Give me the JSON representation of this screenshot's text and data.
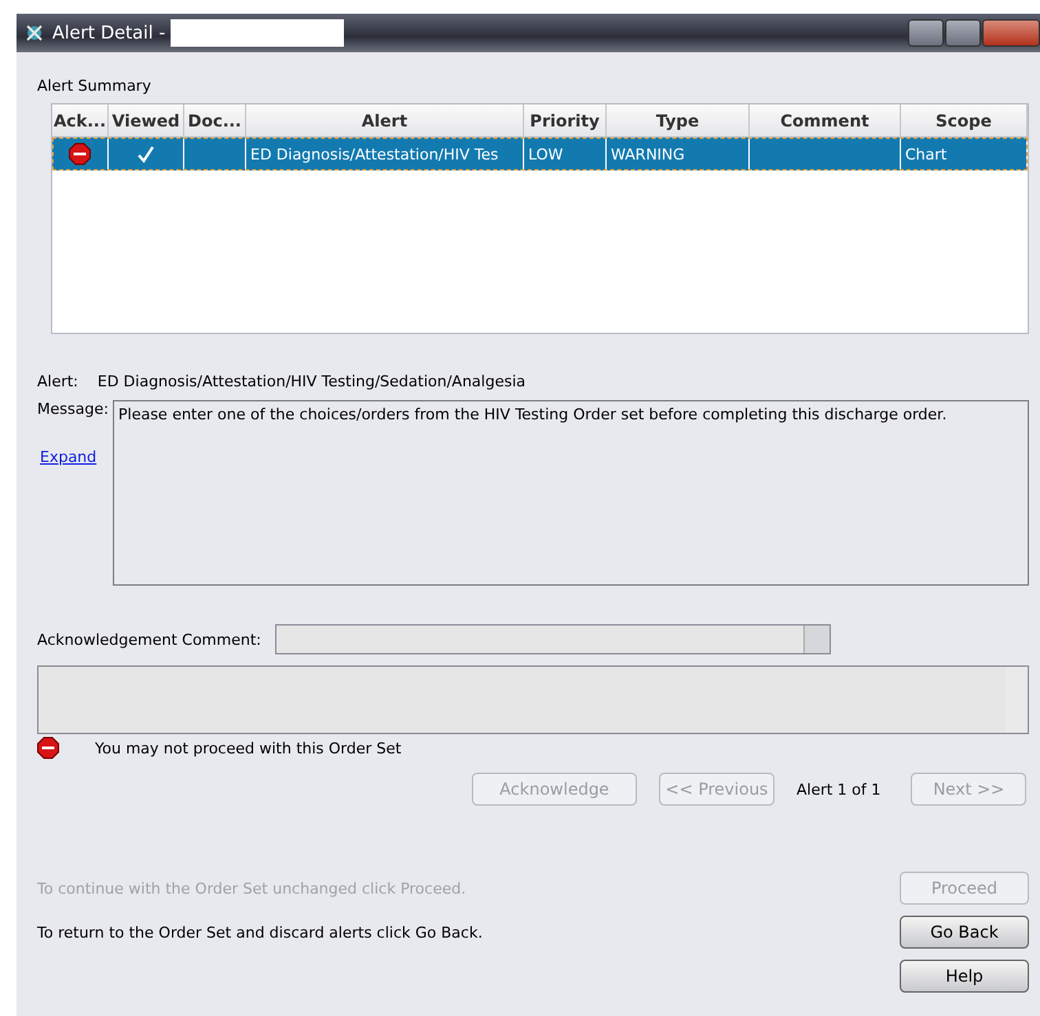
{
  "window": {
    "title": "Alert Detail -"
  },
  "summary": {
    "heading": "Alert Summary",
    "columns": [
      "Ack...",
      "Viewed",
      "Doc...",
      "Alert",
      "Priority",
      "Type",
      "Comment",
      "Scope"
    ],
    "rows": [
      {
        "selected": true,
        "stop": true,
        "viewed": true,
        "alert": "ED Diagnosis/Attestation/HIV Tes",
        "priority": "LOW",
        "type": "WARNING",
        "scope": "Chart"
      }
    ]
  },
  "detail": {
    "alert_label": "Alert:",
    "alert": "ED Diagnosis/Attestation/HIV Testing/Sedation/Analgesia",
    "message_label": "Message:",
    "message": "Please enter one of the choices/orders from the HIV Testing Order set before completing this discharge order.",
    "expand": "Expand"
  },
  "ack_comment_label": "Acknowledgement Comment:",
  "status": "You may not proceed with this Order Set",
  "nav": {
    "acknowledge": {
      "label": "Acknowledge",
      "disabled": true
    },
    "previous": {
      "label": "<< Previous",
      "disabled": true
    },
    "counter": "Alert 1 of 1",
    "next": {
      "label": "Next >>",
      "disabled": true
    }
  },
  "actions": [
    {
      "text": "To continue with the Order Set unchanged click Proceed.",
      "disabled": true,
      "button": "Proceed"
    },
    {
      "text": "To return to the Order Set and discard alerts click Go Back.",
      "disabled": false,
      "button": "Go Back"
    },
    {
      "disabled": false,
      "button": "Help"
    }
  ]
}
